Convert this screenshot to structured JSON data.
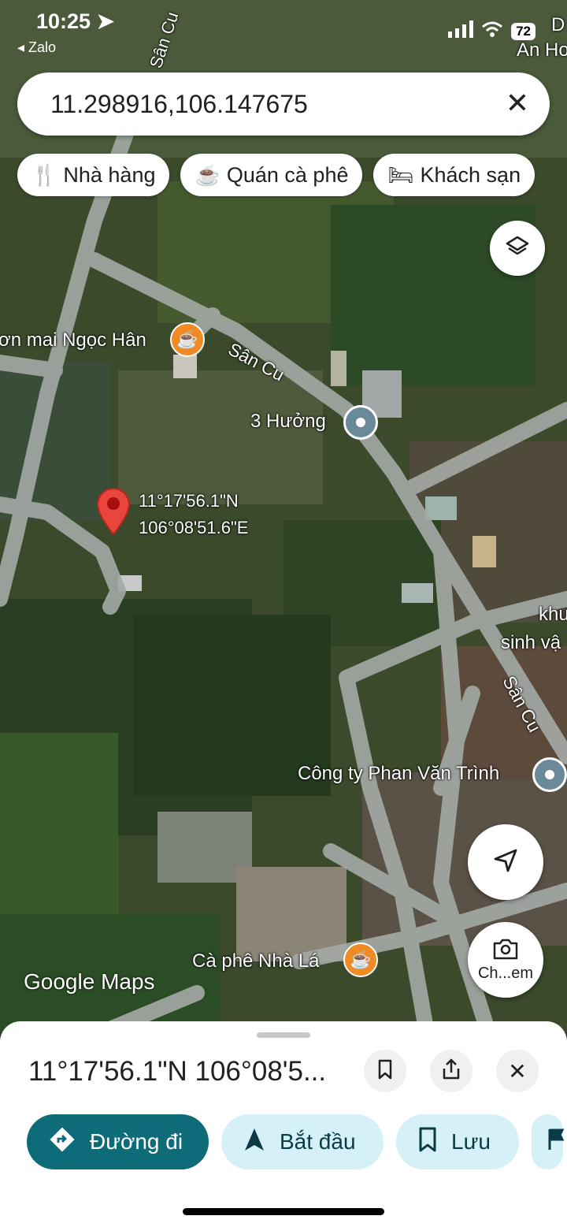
{
  "status_bar": {
    "time": "10:25",
    "back_app": "◂ Zalo",
    "battery": "72"
  },
  "search": {
    "query": "11.298916,106.147675"
  },
  "chips": [
    {
      "label": "Nhà hàng",
      "icon": "restaurant-icon"
    },
    {
      "label": "Quán cà phê",
      "icon": "coffee-icon"
    },
    {
      "label": "Khách sạn",
      "icon": "hotel-icon"
    }
  ],
  "map": {
    "pin_lat": "11°17'56.1\"N",
    "pin_lng": "106°08'51.6\"E",
    "labels": {
      "ngoc_han": "ơn mai Ngọc Hân",
      "san_cu_top": "Sân Cu",
      "san_cu_mid": "Sân Cu",
      "san_cu_right": "Sân Cu",
      "three_huong": "3 Hưởng",
      "phan_van_trinh": "Công ty Phan Văn Trình",
      "ca_phe_nha_la": "Cà phê Nhà Lá",
      "khu": "khu",
      "sinh_vat": "sinh vậ",
      "an_ho": "An Ho",
      "d_edge": "D",
      "camera_btn": "Ch...em"
    },
    "wordmark": "Google Maps"
  },
  "sheet": {
    "title": "11°17'56.1\"N 106°08'5...",
    "actions": [
      {
        "label": "Đường đi",
        "icon": "directions-icon"
      },
      {
        "label": "Bắt đầu",
        "icon": "navigation-arrow-icon"
      },
      {
        "label": "Lưu",
        "icon": "bookmark-icon"
      }
    ]
  },
  "colors": {
    "accent": "#0e6b78",
    "pin": "#d93025",
    "poi_orange": "#f08a24",
    "poi_gray": "#6b8a99"
  }
}
